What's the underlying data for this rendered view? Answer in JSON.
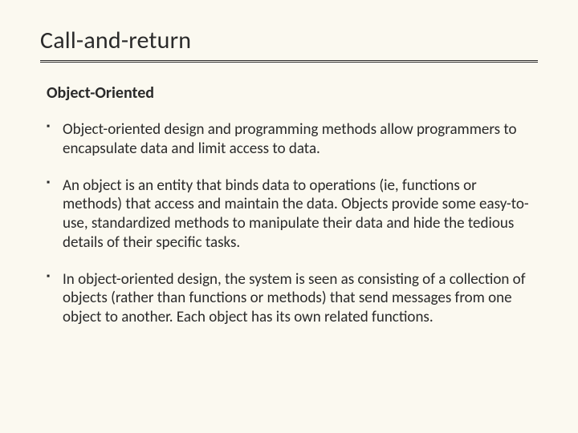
{
  "title": "Call-and-return",
  "subtitle": "Object-Oriented",
  "bullets": [
    "Object-oriented design and programming methods allow programmers to encapsulate data and limit access to data.",
    "An object is an entity that binds data to operations (ie, functions or methods) that access and maintain the data. Objects provide some easy-to-use, standardized methods to manipulate their data and hide the tedious details of their specific tasks.",
    "In object-oriented design, the system is seen as consisting of a collection of objects (rather than functions or methods) that send messages from one object to another. Each object has its own related functions."
  ]
}
